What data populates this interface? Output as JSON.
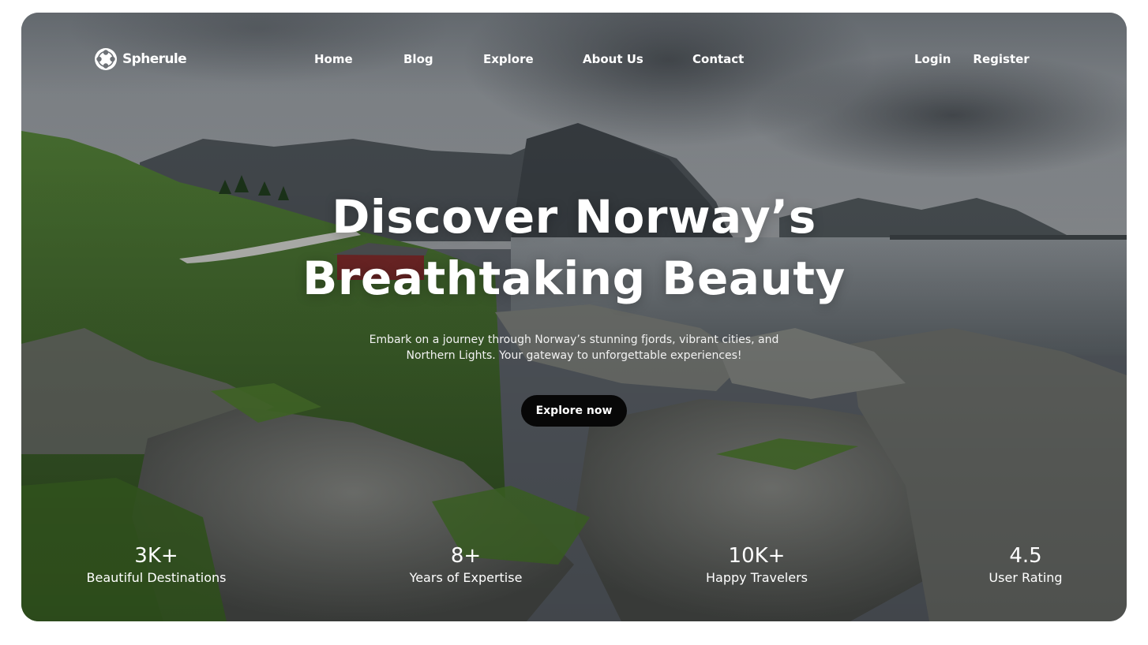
{
  "brand": {
    "name": "Spherule",
    "logo_icon": "sphere-logo-icon"
  },
  "nav": {
    "links": [
      "Home",
      "Blog",
      "Explore",
      "About Us",
      "Contact"
    ],
    "login": "Login",
    "register": "Register"
  },
  "hero": {
    "title_line1": "Discover Norway’s",
    "title_line2": "Breathtaking Beauty",
    "subtitle_line1": "Embark on a journey through Norway’s stunning fjords, vibrant cities, and",
    "subtitle_line2": "Northern Lights. Your gateway to unforgettable experiences!",
    "cta_label": "Explore now",
    "background_image": "norwegian-coastline-photo"
  },
  "stats": [
    {
      "value": "3K+",
      "label": "Beautiful Destinations"
    },
    {
      "value": "8+",
      "label": "Years of Expertise"
    },
    {
      "value": "10K+",
      "label": "Happy Travelers"
    },
    {
      "value": "4.5",
      "label": "User Rating"
    }
  ],
  "colors": {
    "text": "#ffffff",
    "cta_background": "#070707",
    "page_background": "#ffffff"
  }
}
